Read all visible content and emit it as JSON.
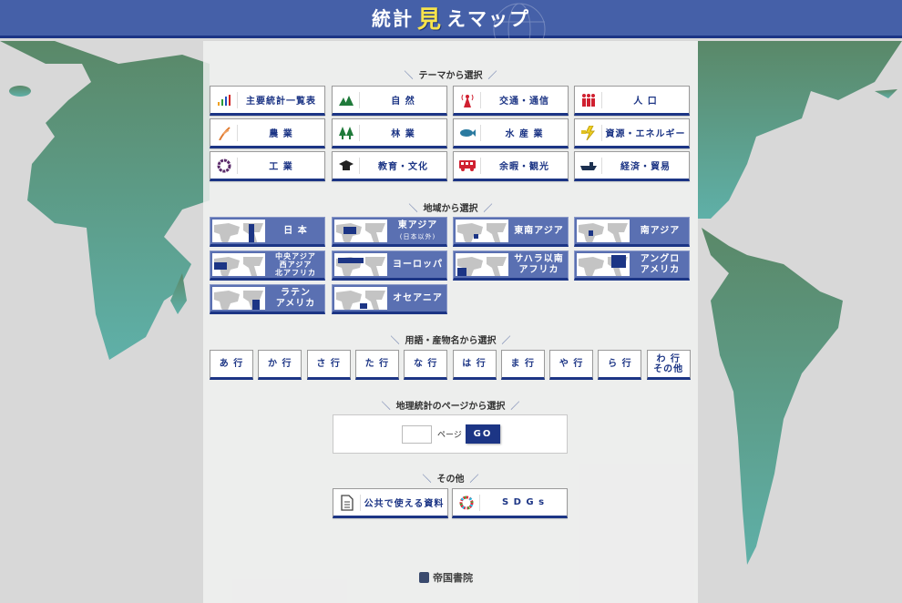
{
  "header": {
    "title_pre": "統計",
    "title_mid": "見",
    "title_post": "えマップ"
  },
  "sections": {
    "theme": "テーマから選択",
    "region": "地域から選択",
    "terms": "用語・産物名から選択",
    "page": "地理統計のページから選択",
    "other": "その他"
  },
  "themes": [
    {
      "label": "主要統計一覧表",
      "icon": "bar-chart-icon"
    },
    {
      "label": "自 然",
      "icon": "mountain-icon"
    },
    {
      "label": "交通・通信",
      "icon": "antenna-icon"
    },
    {
      "label": "人 口",
      "icon": "people-icon"
    },
    {
      "label": "農 業",
      "icon": "wheat-icon"
    },
    {
      "label": "林 業",
      "icon": "tree-icon"
    },
    {
      "label": "水 産 業",
      "icon": "fish-icon"
    },
    {
      "label": "資源・エネルギー",
      "icon": "energy-icon"
    },
    {
      "label": "工 業",
      "icon": "gear-icon"
    },
    {
      "label": "教育・文化",
      "icon": "graduation-cap-icon"
    },
    {
      "label": "余暇・観光",
      "icon": "bus-icon"
    },
    {
      "label": "経済・貿易",
      "icon": "ship-icon"
    }
  ],
  "regions": [
    {
      "lines": [
        "日 本"
      ],
      "sub": "",
      "name": "japan"
    },
    {
      "lines": [
        "東アジア"
      ],
      "sub": "(日本以外)",
      "name": "east-asia"
    },
    {
      "lines": [
        "東南アジア"
      ],
      "sub": "",
      "name": "southeast-asia"
    },
    {
      "lines": [
        "南アジア"
      ],
      "sub": "",
      "name": "south-asia"
    },
    {
      "lines": [
        "中央アジア",
        "西アジア",
        "北アフリカ"
      ],
      "sub": "",
      "name": "central-west-asia-north-africa"
    },
    {
      "lines": [
        "ヨーロッパ"
      ],
      "sub": "",
      "name": "europe"
    },
    {
      "lines": [
        "サハラ以南",
        "アフリカ"
      ],
      "sub": "",
      "name": "sub-saharan-africa"
    },
    {
      "lines": [
        "アングロ",
        "アメリカ"
      ],
      "sub": "",
      "name": "anglo-america"
    },
    {
      "lines": [
        "ラテン",
        "アメリカ"
      ],
      "sub": "",
      "name": "latin-america"
    },
    {
      "lines": [
        "オセアニア"
      ],
      "sub": "",
      "name": "oceania"
    }
  ],
  "kana": [
    {
      "l1": "あ 行",
      "l2": ""
    },
    {
      "l1": "か 行",
      "l2": ""
    },
    {
      "l1": "さ 行",
      "l2": ""
    },
    {
      "l1": "た 行",
      "l2": ""
    },
    {
      "l1": "な 行",
      "l2": ""
    },
    {
      "l1": "は 行",
      "l2": ""
    },
    {
      "l1": "ま 行",
      "l2": ""
    },
    {
      "l1": "や 行",
      "l2": ""
    },
    {
      "l1": "ら 行",
      "l2": ""
    },
    {
      "l1": "わ 行",
      "l2": "その他"
    }
  ],
  "page_select": {
    "input_value": "",
    "label": "ページ",
    "go": "GO"
  },
  "others": [
    {
      "label": "公共で使える資料",
      "icon": "document-icon"
    },
    {
      "label": "S D G s",
      "icon": "sdgs-wheel-icon"
    }
  ],
  "footer": {
    "publisher": "帝国書院"
  },
  "colors": {
    "accent": "#1c3585",
    "header": "#4560a8",
    "region_button": "#5a70b2",
    "land": "#5f9a84"
  }
}
